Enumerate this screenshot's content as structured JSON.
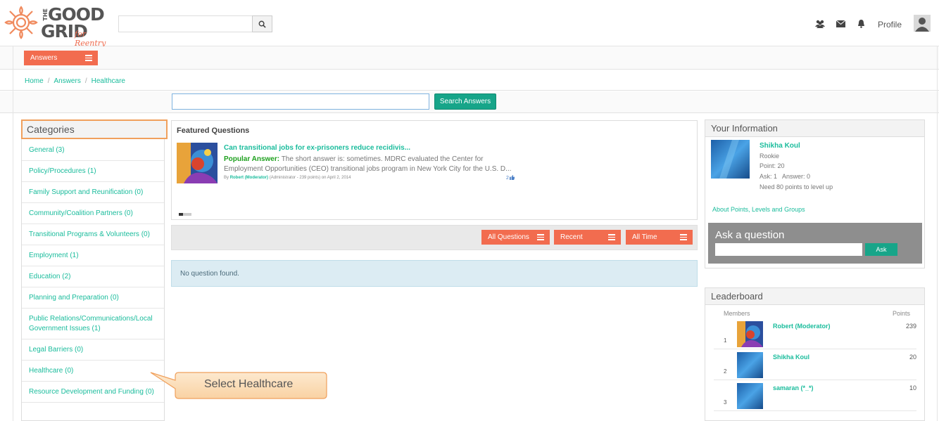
{
  "header": {
    "logo": {
      "the": "THE",
      "good": "GOOD",
      "grid": "GRID",
      "tagline": "for Reentry"
    },
    "search_placeholder": "",
    "search_icon": "search-icon",
    "nav_icons": [
      "users-icon",
      "envelope-icon",
      "bell-icon"
    ],
    "profile_label": "Profile"
  },
  "menu": {
    "answers_label": "Answers"
  },
  "breadcrumb": [
    "Home",
    "Answers",
    "Healthcare"
  ],
  "answers_search": {
    "value": "",
    "button_label": "Search Answers"
  },
  "categories": {
    "title": "Categories",
    "items": [
      "General (3)",
      "Policy/Procedures (1)",
      "Family Support and Reunification (0)",
      "Community/Coalition Partners (0)",
      "Transitional Programs & Volunteers (0)",
      "Employment (1)",
      "Education (2)",
      "Planning and Preparation (0)",
      "Public Relations/Communications/Local Government Issues (1)",
      "Legal Barriers (0)",
      "Healthcare (0)",
      "Resource Development and Funding (0)"
    ]
  },
  "featured": {
    "title": "Featured Questions",
    "question": "Can transitional jobs for ex-prisoners reduce recidivis...",
    "answer_label": "Popular Answer:",
    "answer_text": "The short answer is: sometimes. MDRC evaluated the Center for Employment Opportunities (CEO) transitional jobs program in New York City for the U.S. D...",
    "meta_by": "By",
    "meta_author": "Robert (Moderator)",
    "meta_role": "(Administrator - 239 points)",
    "meta_date": "on April 2, 2014",
    "votes": "2"
  },
  "filters": [
    "All Questions",
    "Recent",
    "All Time"
  ],
  "no_questions": "No question found.",
  "your_info": {
    "title": "Your Information",
    "name": "Shikha Koul",
    "rank": "Rookie",
    "points": "Point: 20",
    "ask_answer": "Ask: 1   Answer: 0",
    "level": "Need 80 points to level up",
    "link": "About Points, Levels and Groups"
  },
  "ask": {
    "title": "Ask a question",
    "value": "",
    "button_label": "Ask"
  },
  "leaderboard": {
    "title": "Leaderboard",
    "col_members": "Members",
    "col_points": "Points",
    "rows": [
      {
        "rank": "1",
        "name": "Robert (Moderator)",
        "points": "239"
      },
      {
        "rank": "2",
        "name": "Shikha Koul",
        "points": "20"
      },
      {
        "rank": "3",
        "name": "samaran (*_*)",
        "points": "10"
      }
    ]
  },
  "callout": {
    "text": "Select Healthcare"
  },
  "colors": {
    "accent": "#f26c4f",
    "link": "#1abc9c",
    "button": "#17a589"
  }
}
